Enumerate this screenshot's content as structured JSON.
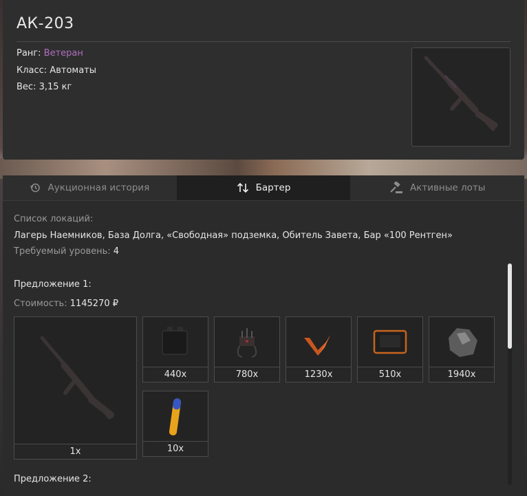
{
  "item": {
    "name": "АК-203",
    "rank_label": "Ранг:",
    "rank_value": "Ветеран",
    "class_text": "Класс: Автоматы",
    "weight_text": "Вес: 3,15 кг"
  },
  "tabs": [
    {
      "label": "Аукционная история",
      "icon": "history-icon",
      "active": false
    },
    {
      "label": "Бартер",
      "icon": "swap-arrows-icon",
      "active": true
    },
    {
      "label": "Активные лоты",
      "icon": "gavel-icon",
      "active": false
    }
  ],
  "barter": {
    "locations_label": "Список локаций:",
    "locations": "Лагерь Наемников, База Долга, «Свободная» подземка, Обитель Завета, Бар «100 Рентген»",
    "level_label": "Требуемый уровень:",
    "level_value": "4",
    "offers": [
      {
        "title": "Предложение 1:",
        "cost_label": "Стоимость:",
        "cost_value": "1145270 ₽",
        "result_qty": "1x",
        "ingredients": [
          {
            "icon": "battery-icon",
            "qty": "440x"
          },
          {
            "icon": "device-icon",
            "qty": "780x"
          },
          {
            "icon": "orange-plant-icon",
            "qty": "1230x"
          },
          {
            "icon": "tablet-icon",
            "qty": "510x"
          },
          {
            "icon": "rock-icon",
            "qty": "1940x"
          },
          {
            "icon": "vial-icon",
            "qty": "10x"
          }
        ]
      },
      {
        "title": "Предложение 2:"
      }
    ]
  },
  "colors": {
    "rank": "#b06fc0",
    "active_tab": "#1f1f1f",
    "panel": "#2b2b2b"
  }
}
